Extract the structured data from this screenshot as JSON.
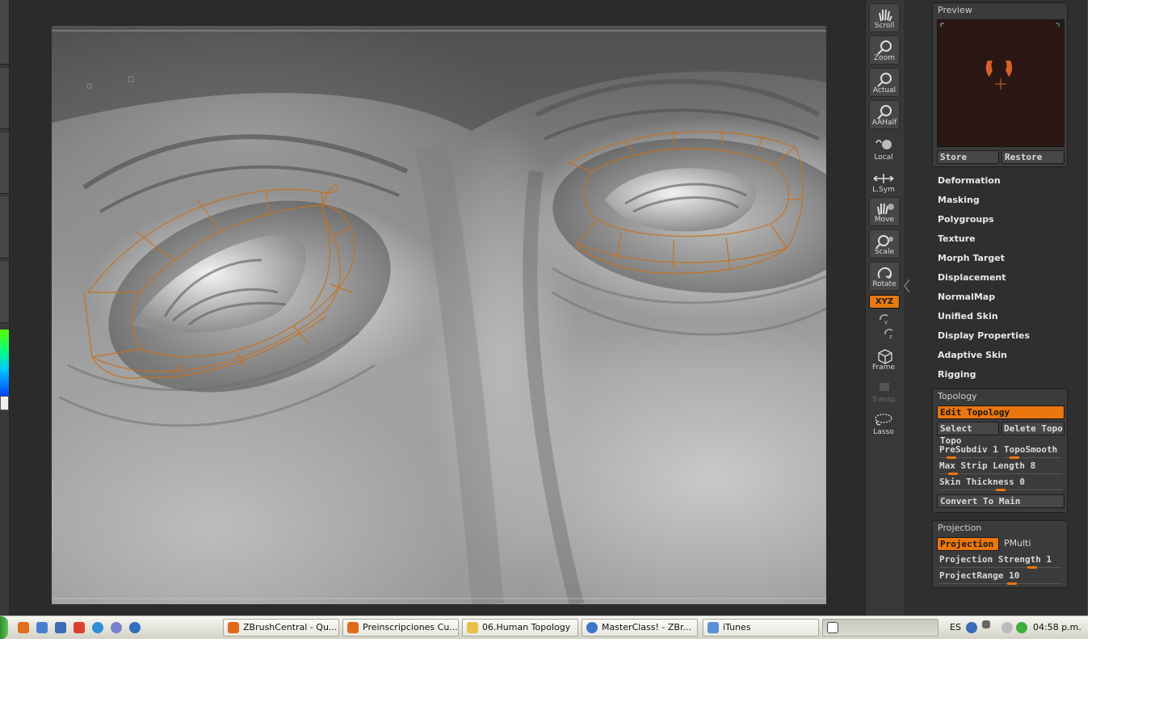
{
  "shelf": {
    "tools": [
      "Scroll",
      "Zoom",
      "Actual",
      "AAHalf",
      "Local",
      "L.Sym",
      "Move",
      "Scale",
      "Rotate"
    ],
    "xyz_label": "XYZ",
    "frame": "Frame",
    "transp": "Transp",
    "lasso": "Lasso"
  },
  "preview": {
    "title": "Preview",
    "store": "Store",
    "restore": "Restore"
  },
  "tool_menus": [
    "Deformation",
    "Masking",
    "Polygroups",
    "Texture",
    "Morph Target",
    "Displacement",
    "NormalMap",
    "Unified Skin",
    "Display Properties",
    "Adaptive Skin",
    "Rigging"
  ],
  "topology": {
    "title": "Topology",
    "edit": "Edit Topology",
    "select": "Select Topo",
    "delete": "Delete Topo",
    "presubdiv": "PreSubdiv 1",
    "presubdiv_level": 0.15,
    "toposmooth": "TopoSmooth",
    "toposmooth_level": 0.12,
    "max_strip": "Max Strip Length 8",
    "max_strip_level": 0.08,
    "skin_thickness": "Skin Thickness 0",
    "skin_thickness_level": 0.5,
    "convert": "Convert To Main"
  },
  "projection": {
    "title": "Projection",
    "projection_btn": "Projection",
    "pmulti": "PMulti",
    "strength": "Projection Strength 1",
    "strength_level": 0.78,
    "range": "ProjectRange 10",
    "range_level": 0.6
  },
  "taskbar": {
    "tasks": [
      {
        "label": "ZBrushCentral - Qu...",
        "color": "#e06a1c"
      },
      {
        "label": "Preinscripciones Cu...",
        "color": "#e06a1c"
      },
      {
        "label": "06.Human Topology",
        "color": "#e8c04a"
      },
      {
        "label": "MasterClass! - ZBr...",
        "color": "#3b78c9"
      },
      {
        "label": "iTunes",
        "color": "#5a8fd6"
      }
    ],
    "lang": "ES",
    "clock": "04:58 p.m."
  },
  "colors": {
    "accent": "#e9760e",
    "wireframe": "#c8711c"
  }
}
